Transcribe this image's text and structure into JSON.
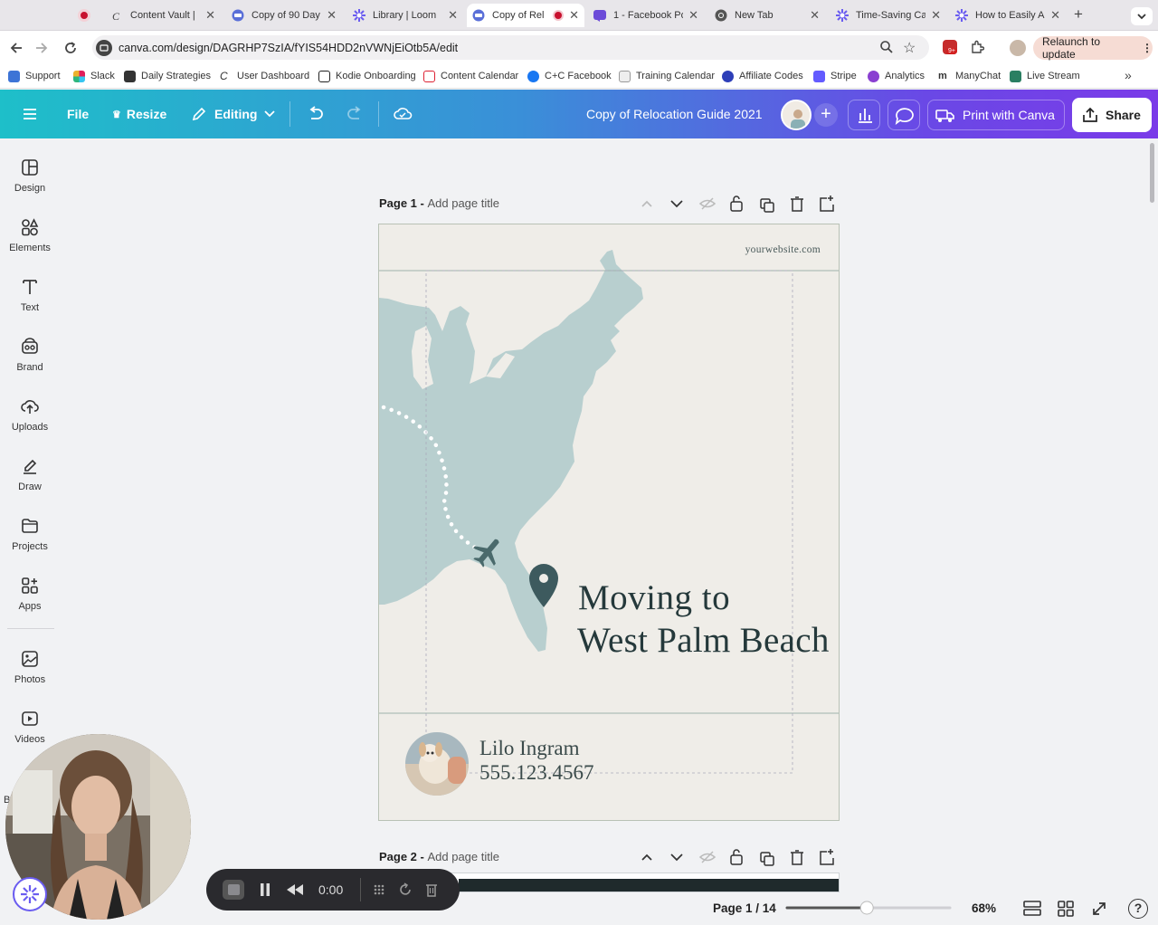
{
  "browser": {
    "tabs": [
      {
        "label": "Content Vault |",
        "icon": "content-vault-icon"
      },
      {
        "label": "Copy of 90 Day",
        "icon": "canva-icon"
      },
      {
        "label": "Library | Loom",
        "icon": "loom-icon"
      },
      {
        "label": "Copy of Rel",
        "icon": "canva-icon",
        "active": true
      },
      {
        "label": "1 - Facebook Po",
        "icon": "facebook-post-icon"
      },
      {
        "label": "New Tab",
        "icon": "chrome-icon"
      },
      {
        "label": "Time-Saving Ca",
        "icon": "loom-icon"
      },
      {
        "label": "How to Easily A",
        "icon": "loom-icon"
      }
    ],
    "url": "canva.com/design/DAGRHP7SzIA/fYIS54HDD2nVWNjEiOtb5A/edit",
    "extension_badge": "9+",
    "relaunch_label": "Relaunch to update",
    "bookmarks": [
      "Support",
      "Slack",
      "Daily Strategies",
      "User Dashboard",
      "Kodie Onboarding",
      "Content Calendar",
      "C+C Facebook",
      "Training Calendar",
      "Affiliate Codes",
      "Stripe",
      "Analytics",
      "ManyChat",
      "Live Stream"
    ]
  },
  "toolbar": {
    "file_label": "File",
    "resize_label": "Resize",
    "editing_label": "Editing",
    "doc_title": "Copy of Relocation Guide 2021",
    "print_label": "Print with Canva",
    "share_label": "Share"
  },
  "sidebar": {
    "items": [
      {
        "label": "Design",
        "icon": "design-icon"
      },
      {
        "label": "Elements",
        "icon": "elements-icon"
      },
      {
        "label": "Text",
        "icon": "text-icon"
      },
      {
        "label": "Brand",
        "icon": "brand-icon"
      },
      {
        "label": "Uploads",
        "icon": "uploads-icon"
      },
      {
        "label": "Draw",
        "icon": "draw-icon"
      },
      {
        "label": "Projects",
        "icon": "projects-icon"
      },
      {
        "label": "Apps",
        "icon": "apps-icon"
      },
      {
        "label": "Photos",
        "icon": "photos-icon"
      },
      {
        "label": "Videos",
        "icon": "videos-icon"
      }
    ],
    "partial_label": "B"
  },
  "canvas": {
    "page1": {
      "prefix": "Page 1 -",
      "placeholder": "Add page title",
      "website": "yourwebsite.com",
      "headline_line1": "Moving to",
      "headline_line2": "West Palm Beach",
      "agent_name": "Lilo Ingram",
      "agent_phone": "555.123.4567"
    },
    "page2": {
      "prefix": "Page 2 -",
      "placeholder": "Add page title"
    }
  },
  "recorder": {
    "time": "0:00"
  },
  "footer": {
    "page_indicator": "Page 1 / 14",
    "zoom": "68%",
    "zoom_level": 0.68
  },
  "colors": {
    "map": "#b8cfcf",
    "pin": "#3d5a5e",
    "page_bg": "#efede8",
    "accent_purple": "#7a3be8",
    "accent_teal": "#1ebfc9"
  }
}
